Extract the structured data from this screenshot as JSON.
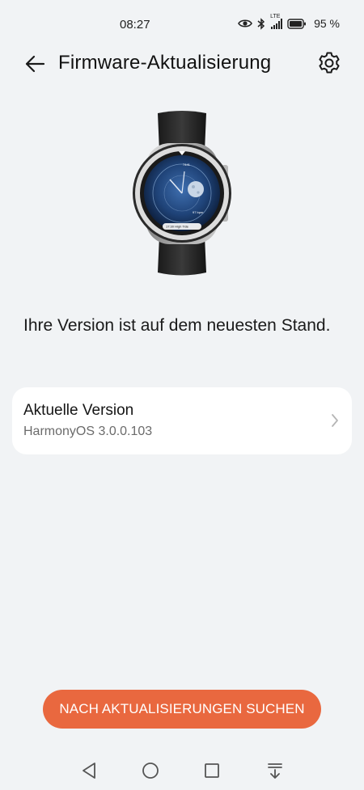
{
  "status_bar": {
    "time": "08:27",
    "battery": "95 %",
    "network": "LTE",
    "icons": [
      "eye-icon",
      "bluetooth-icon",
      "signal-icon",
      "battery-icon"
    ]
  },
  "header": {
    "title": "Firmware-Aktualisierung",
    "back_icon": "arrow-left-icon",
    "settings_icon": "gear-icon"
  },
  "watch_face": {
    "readouts": [
      "7441",
      "17:30 High Tide",
      "97 bpm"
    ]
  },
  "main": {
    "status_message": "Ihre Version ist auf dem neuesten Stand.",
    "version_card": {
      "title": "Aktuelle Version",
      "value": "HarmonyOS 3.0.0.103"
    },
    "check_button_label": "NACH AKTUALISIERUNGEN SUCHEN"
  },
  "nav": {
    "items": [
      "back-triangle-icon",
      "home-circle-icon",
      "recents-square-icon",
      "notification-down-icon"
    ]
  },
  "colors": {
    "accent": "#e9683f",
    "background": "#f1f3f5",
    "card": "#ffffff"
  }
}
